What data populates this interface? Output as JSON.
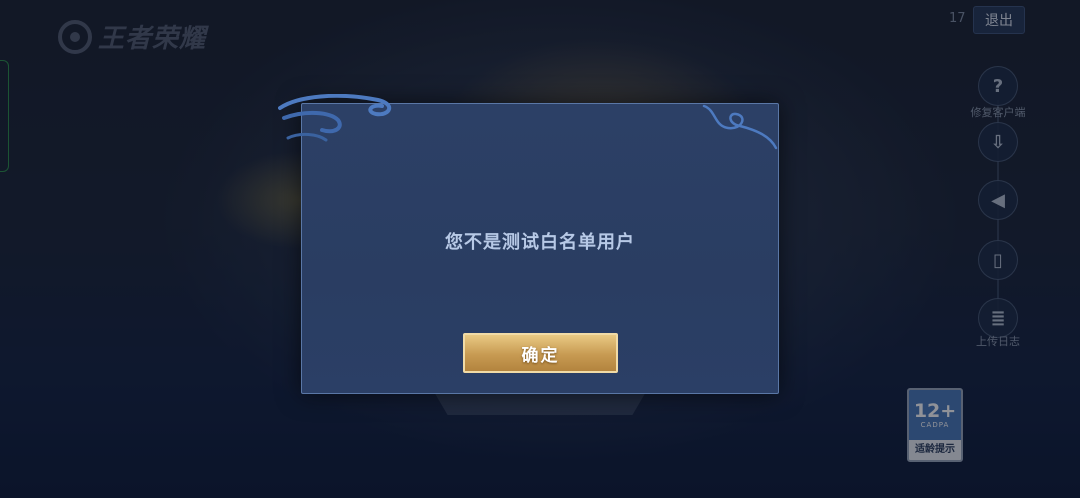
{
  "header": {
    "logo_text": "王者荣耀",
    "count": "17",
    "exit_label": "退出"
  },
  "side_tools": [
    {
      "icon": "question-icon",
      "glyph": "?",
      "label": "修复客户端"
    },
    {
      "icon": "download-icon",
      "glyph": "⇩",
      "label": ""
    },
    {
      "icon": "speaker-icon",
      "glyph": "◀",
      "label": ""
    },
    {
      "icon": "phone-icon",
      "glyph": "▯",
      "label": ""
    },
    {
      "icon": "log-icon",
      "glyph": "≣",
      "label": "上传日志"
    }
  ],
  "age_rating": {
    "number": "12+",
    "org": "CADPA",
    "note": "适龄提示"
  },
  "dialog": {
    "message": "您不是测试白名单用户",
    "confirm_label": "确定"
  },
  "colors": {
    "dialog_bg": "#2c4066",
    "dialog_border": "#5a77a6",
    "button_gold": "#c79a52",
    "message_text": "#b7c9e6"
  }
}
